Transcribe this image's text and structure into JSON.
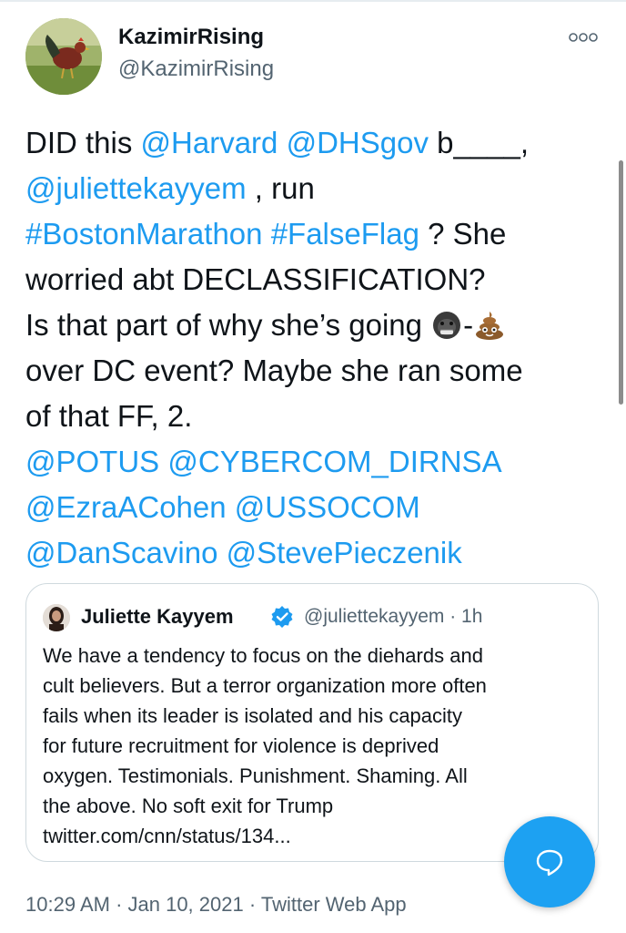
{
  "author": {
    "display_name": "KazimirRising",
    "handle": "@KazimirRising"
  },
  "tweet": {
    "lines": [
      [
        {
          "text": "DID this ",
          "type": "text"
        },
        {
          "text": "@Harvard",
          "type": "mention"
        },
        {
          "text": " ",
          "type": "text"
        },
        {
          "text": "@DHSgov",
          "type": "mention"
        },
        {
          "text": "  b____,",
          "type": "text"
        }
      ],
      [
        {
          "text": "@juliettekayyem",
          "type": "mention"
        },
        {
          "text": " , run",
          "type": "text"
        }
      ],
      [
        {
          "text": "#BostonMarathon",
          "type": "hashtag"
        },
        {
          "text": " ",
          "type": "text"
        },
        {
          "text": "#FalseFlag",
          "type": "hashtag"
        },
        {
          "text": " ? She",
          "type": "text"
        }
      ],
      [
        {
          "text": "worried abt DECLASSIFICATION?",
          "type": "text"
        }
      ],
      [
        {
          "text": "Is that part of why she’s going ",
          "type": "text"
        },
        {
          "text": "gorilla",
          "type": "emoji"
        },
        {
          "text": "-",
          "type": "text"
        },
        {
          "text": "poop",
          "type": "emoji"
        }
      ],
      [
        {
          "text": "over DC event? Maybe she ran some",
          "type": "text"
        }
      ],
      [
        {
          "text": "of that FF, 2.",
          "type": "text"
        }
      ],
      [
        {
          "text": "@POTUS",
          "type": "mention"
        },
        {
          "text": " ",
          "type": "text"
        },
        {
          "text": "@CYBERCOM_DIRNSA",
          "type": "mention"
        }
      ],
      [
        {
          "text": "@EzraACohen",
          "type": "mention"
        },
        {
          "text": " ",
          "type": "text"
        },
        {
          "text": "@USSOCOM",
          "type": "mention"
        }
      ],
      [
        {
          "text": "@DanScavino",
          "type": "mention"
        },
        {
          "text": " ",
          "type": "text"
        },
        {
          "text": "@StevePieczenik",
          "type": "mention"
        }
      ]
    ]
  },
  "quoted_tweet": {
    "display_name": "Juliette Kayyem",
    "handle_time": "@juliettekayyem · 1h",
    "lines": [
      "We have a tendency to focus on the diehards and",
      "cult believers. But a terror organization more often",
      "fails when its leader is isolated and his capacity",
      "for future recruitment for violence is deprived",
      "oxygen. Testimonials. Punishment. Shaming. All",
      "the above. No soft exit for Trump",
      "twitter.com/cnn/status/134..."
    ]
  },
  "meta": {
    "timestamp": "10:29 AM · Jan 10, 2021 · Twitter Web App"
  },
  "colors": {
    "link": "#1d9bf0",
    "fab": "#1da1f2",
    "secondary_text": "#536471",
    "border": "#cfd9de"
  },
  "icons": {
    "more": "more-horizontal-icon",
    "verified": "verified-badge-icon",
    "compose": "chat-bubble-icon"
  }
}
